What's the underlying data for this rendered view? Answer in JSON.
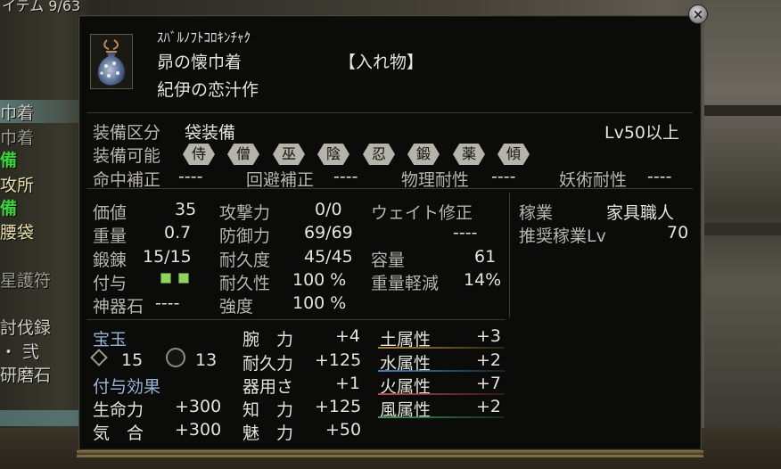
{
  "background": {
    "top_left": "イテム 9/63",
    "sidebar": [
      "巾着",
      "巾着",
      "備",
      "攻所",
      "備",
      "腰袋",
      "星護符",
      "討伐録",
      "・ 弐",
      "研磨石"
    ]
  },
  "item": {
    "reading": "ｽﾊﾞﾙﾉﾌﾄｺﾛｷﾝﾁｬｸ",
    "name": "昴の懐巾着",
    "category": "【入れ物】",
    "maker": "紀伊の恋汁作"
  },
  "equip": {
    "class_label": "装備区分",
    "class_value": "袋装備",
    "level_req": "Lv50以上",
    "usable_label": "装備可能",
    "usable": [
      "侍",
      "僧",
      "巫",
      "陰",
      "忍",
      "鍛",
      "薬",
      "傾"
    ]
  },
  "corrections": [
    {
      "label": "命中補正",
      "value": "----"
    },
    {
      "label": "回避補正",
      "value": "----"
    },
    {
      "label": "物理耐性",
      "value": "----"
    },
    {
      "label": "妖術耐性",
      "value": "----"
    }
  ],
  "stats": {
    "price_label": "価値",
    "price": "35",
    "weight_label": "重量",
    "weight": "0.7",
    "forge_label": "鍛錬",
    "forge": "15/15",
    "enchant_label": "付与",
    "enchant_slots_filled": 2,
    "shinki_label": "神器石",
    "shinki": "----",
    "attack_label": "攻撃力",
    "attack": "0/0",
    "defense_label": "防御力",
    "defense": "69/69",
    "durability_label": "耐久度",
    "durability": "45/45",
    "dur_rate_label": "耐久性",
    "dur_rate": "100 %",
    "strength_label": "強度",
    "strength": "100 %",
    "weight_mod_label": "ウェイト修正",
    "weight_mod": "----",
    "capacity_label": "容量",
    "capacity": "61",
    "weight_reduce_label": "重量軽減",
    "weight_reduce": "14%"
  },
  "trade": {
    "label": "稼業",
    "value": "家具職人",
    "rec_label": "推奨稼業Lv",
    "rec_value": "70"
  },
  "gems": {
    "label": "宝玉",
    "diamond_count": "15",
    "circle_count": "13"
  },
  "effects_label": "付与効果",
  "effects_left": [
    {
      "label": "生命力",
      "value": "+300"
    },
    {
      "label": "気　合",
      "value": "+300"
    }
  ],
  "effects_mid": [
    {
      "label": "腕　力",
      "value": "+4"
    },
    {
      "label": "耐久力",
      "value": "+125"
    },
    {
      "label": "器用さ",
      "value": "+1"
    },
    {
      "label": "知　力",
      "value": "+125"
    },
    {
      "label": "魅　力",
      "value": "+50"
    }
  ],
  "elements": [
    {
      "label": "土属性",
      "value": "+3",
      "color": "#a8862c"
    },
    {
      "label": "水属性",
      "value": "+2",
      "color": "#3c7fb8"
    },
    {
      "label": "火属性",
      "value": "+7",
      "color": "#b84a48"
    },
    {
      "label": "風属性",
      "value": "+2",
      "color": "#3e9a5a"
    }
  ],
  "icons": {
    "close": "close-icon",
    "item": "pouch-icon"
  }
}
